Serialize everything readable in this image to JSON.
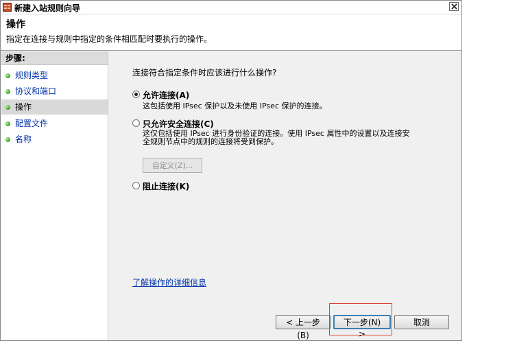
{
  "window": {
    "title": "新建入站规则向导",
    "close_symbol": "×"
  },
  "header": {
    "title": "操作",
    "subtitle": "指定在连接与规则中指定的条件相匹配时要执行的操作。"
  },
  "steps": {
    "title": "步骤:",
    "items": [
      {
        "label": "规则类型"
      },
      {
        "label": "协议和端口"
      },
      {
        "label": "操作",
        "current": true
      },
      {
        "label": "配置文件"
      },
      {
        "label": "名称"
      }
    ]
  },
  "content": {
    "question": "连接符合指定条件时应该进行什么操作?",
    "options": [
      {
        "label": "允许连接(A)",
        "selected": true,
        "description": [
          "这包括使用 IPsec 保护以及未使用 IPsec 保护的连接。"
        ]
      },
      {
        "label": "只允许安全连接(C)",
        "selected": false,
        "description": [
          "这仅包括使用 IPsec 进行身份验证的连接。使用 IPsec 属性中的设置以及连接安",
          "全规则节点中的规则的连接将受到保护。"
        ]
      },
      {
        "label": "阻止连接(K)",
        "selected": false,
        "description": []
      }
    ],
    "customize_label": "自定义(Z)...",
    "learn_more": "了解操作的详细信息"
  },
  "buttons": {
    "back": "< 上一步(B)",
    "next": "下一步(N) >",
    "cancel": "取消"
  },
  "colors": {
    "link": "#0033aa",
    "highlight": "#e0402a",
    "step_dot": "#2fa020"
  }
}
